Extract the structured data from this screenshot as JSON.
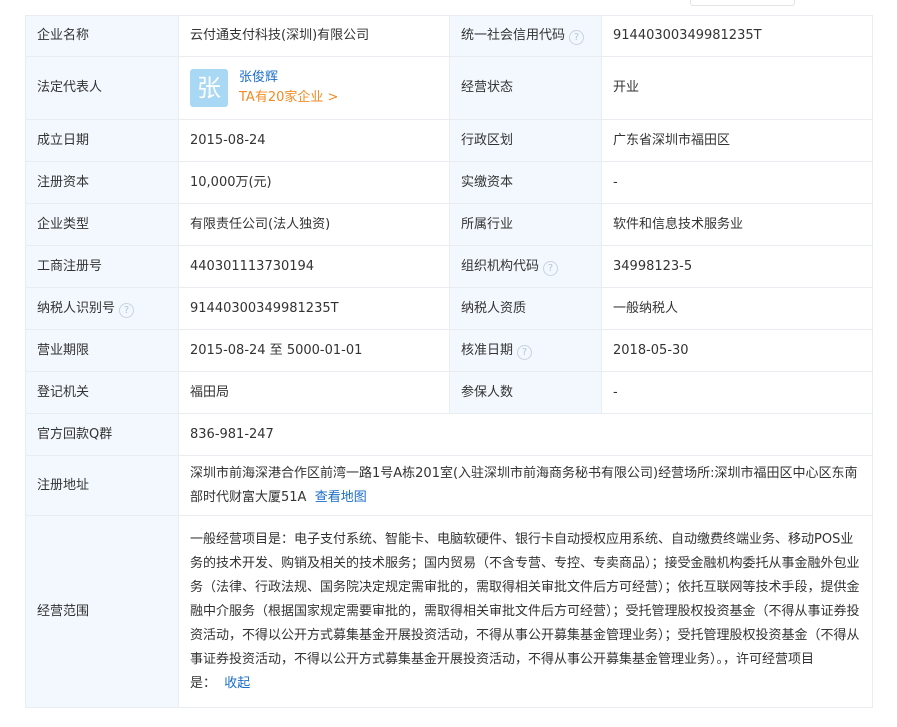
{
  "rows": [
    {
      "l1": "企业名称",
      "v1": "云付通支付科技(深圳)有限公司",
      "l2": "统一社会信用代码",
      "v2": "91440300349981235T"
    },
    {
      "l1": "法定代表人",
      "l2": "经营状态",
      "v2": "开业"
    },
    {
      "l1": "成立日期",
      "v1": "2015-08-24",
      "l2": "行政区划",
      "v2": "广东省深圳市福田区"
    },
    {
      "l1": "注册资本",
      "v1": "10,000万(元)",
      "l2": "实缴资本",
      "v2": "-"
    },
    {
      "l1": "企业类型",
      "v1": "有限责任公司(法人独资)",
      "l2": "所属行业",
      "v2": "软件和信息技术服务业"
    },
    {
      "l1": "工商注册号",
      "v1": "440301113730194",
      "l2": "组织机构代码",
      "v2": "34998123-5"
    },
    {
      "l1": "纳税人识别号",
      "v1": "91440300349981235T",
      "l2": "纳税人资质",
      "v2": "一般纳税人"
    },
    {
      "l1": "营业期限",
      "v1": "2015-08-24 至 5000-01-01",
      "l2": "核准日期",
      "v2": "2018-05-30"
    },
    {
      "l1": "登记机关",
      "v1": "福田局",
      "l2": "参保人数",
      "v2": "-"
    }
  ],
  "legal_rep": {
    "avatar_char": "张",
    "name": "张俊辉",
    "companies": "TA有20家企业 >"
  },
  "help_glyph": "?",
  "qq": {
    "label": "官方回款Q群",
    "value": "836-981-247"
  },
  "address": {
    "label": "注册地址",
    "value": "深圳市前海深港合作区前湾一路1号A栋201室(入驻深圳市前海商务秘书有限公司)经营场所:深圳市福田区中心区东南部时代财富大厦51A",
    "map_link": "查看地图"
  },
  "scope": {
    "label": "经营范围",
    "value": "一般经营项目是：电子支付系统、智能卡、电脑软硬件、银行卡自动授权应用系统、自动缴费终端业务、移动POS业务的技术开发、购销及相关的技术服务；国内贸易（不含专营、专控、专卖商品）；接受金融机构委托从事金融外包业务（法律、行政法规、国务院决定规定需审批的，需取得相关审批文件后方可经营）；依托互联网等技术手段，提供金融中介服务（根据国家规定需要审批的，需取得相关审批文件后方可经营）；受托管理股权投资基金（不得从事证券投资活动，不得以公开方式募集基金开展投资活动，不得从事公开募集基金管理业务）；受托管理股权投资基金（不得从事证券投资活动，不得以公开方式募集基金开展投资活动，不得从事公开募集基金管理业务）。，许可经营项目是：",
    "collapse_link": "收起"
  }
}
